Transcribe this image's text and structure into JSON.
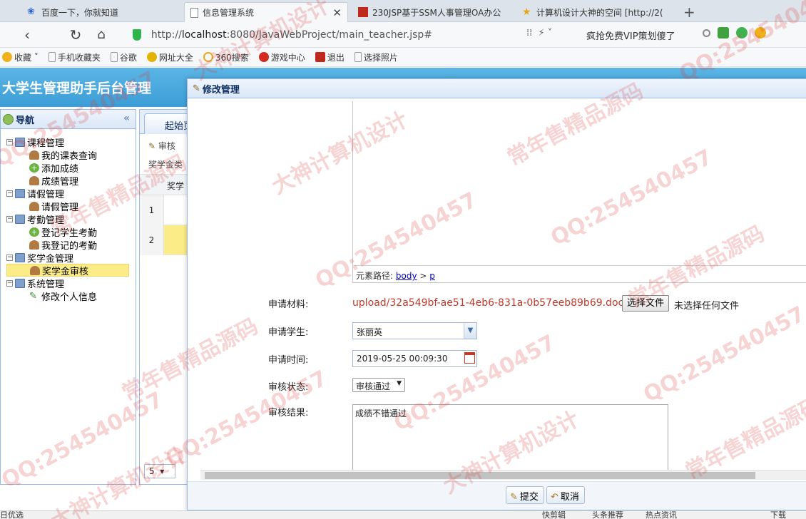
{
  "browser": {
    "tabs": [
      {
        "label": "百度一下，你就知道",
        "favicon": "baidu-icon"
      },
      {
        "label": "信息管理系统",
        "favicon": "page-icon",
        "active": true
      },
      {
        "label": "230JSP基于SSM人事管理OA办公",
        "favicon": "red-square-icon"
      },
      {
        "label": "计算机设计大神的空间 [http://2(",
        "favicon": "star-icon"
      }
    ],
    "url_prefix": "http://",
    "url_host": "localhost",
    "url_rest": ":8080/JavaWebProject/main_teacher.jsp#",
    "promo": "疯抢免费VIP策划傻了",
    "bookmarks": [
      "收藏",
      "手机收藏夹",
      "谷歌",
      "网址大全",
      "360搜索",
      "游戏中心",
      "退出",
      "选择照片"
    ]
  },
  "app": {
    "title": "大学生管理助手后台管理",
    "nav_title": "导航",
    "tree": [
      {
        "label": "课程管理",
        "type": "parent"
      },
      {
        "label": "我的课表查询",
        "type": "child",
        "icon": "person"
      },
      {
        "label": "添加成绩",
        "type": "child",
        "icon": "add"
      },
      {
        "label": "成绩管理",
        "type": "child",
        "icon": "person"
      },
      {
        "label": "请假管理",
        "type": "parent"
      },
      {
        "label": "请假管理",
        "type": "child",
        "icon": "person"
      },
      {
        "label": "考勤管理",
        "type": "parent"
      },
      {
        "label": "登记学生考勤",
        "type": "child",
        "icon": "add"
      },
      {
        "label": "我登记的考勤",
        "type": "child",
        "icon": "person"
      },
      {
        "label": "奖学金管理",
        "type": "parent"
      },
      {
        "label": "奖学金审核",
        "type": "child",
        "icon": "person",
        "selected": true
      },
      {
        "label": "系统管理",
        "type": "parent"
      },
      {
        "label": "修改个人信息",
        "type": "child",
        "icon": "edit"
      }
    ],
    "center": {
      "tab_label": "起始页",
      "toolbar_label": "审核",
      "filter_label": "奖学金类",
      "grid_header": "奖学",
      "rows": [
        "1",
        "2"
      ],
      "page_size": "5"
    }
  },
  "dialog": {
    "title": "修改管理",
    "element_path_label": "元素路径:",
    "element_path": [
      "body",
      "p"
    ],
    "fields": {
      "material_label": "申请材料:",
      "material_value": "upload/32a549bf-ae51-4eb6-831a-0b57eeb89b69.doc",
      "choose_file": "选择文件",
      "no_file": "未选择任何文件",
      "student_label": "申请学生:",
      "student_value": "张丽英",
      "time_label": "申请时间:",
      "time_value": "2019-05-25 00:09:30",
      "status_label": "审核状态:",
      "status_value": "审核通过",
      "result_label": "审核结果:",
      "result_value": "成绩不错通过"
    },
    "submit": "提交",
    "cancel": "取消"
  },
  "statusbar": {
    "left": "日优选",
    "items": [
      "快剪辑",
      "头条推荐",
      "热点资讯",
      "下载"
    ]
  },
  "watermarks": [
    "QQ:254540457",
    "常年售精品源码",
    "大神计算机设计"
  ]
}
